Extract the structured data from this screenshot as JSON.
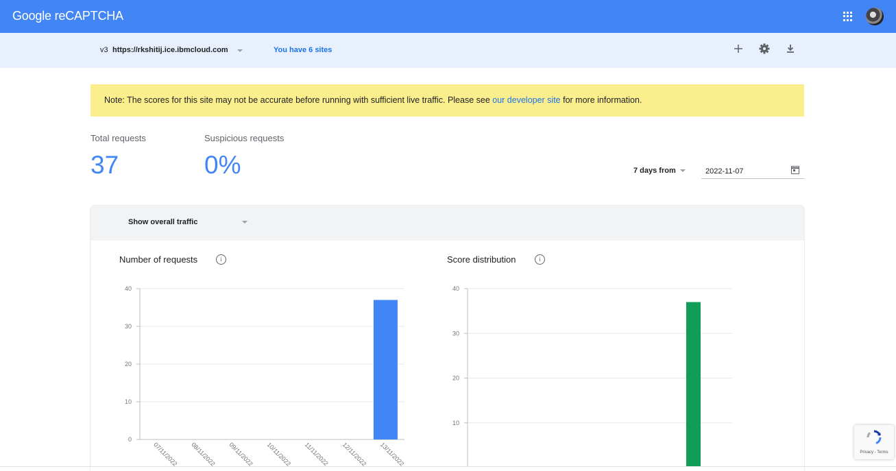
{
  "header": {
    "brand_google": "Google",
    "brand_product": "reCAPTCHA",
    "apps_icon": "apps-grid-icon",
    "avatar": "user-avatar"
  },
  "site_bar": {
    "version": "v3",
    "site_name": "https://rkshitij.ice.ibmcloud.com",
    "sites_link": "You have 6 sites",
    "actions": [
      "add-icon",
      "gear-icon",
      "download-icon"
    ]
  },
  "note": {
    "before_link": "Note: The scores for this site may not be accurate before running with sufficient live traffic. Please see ",
    "link_text": "our developer site",
    "after_link": " for more information."
  },
  "stats": {
    "total_label": "Total requests",
    "total_value": "37",
    "suspicious_label": "Suspicious requests",
    "suspicious_value": "0%"
  },
  "date_range": {
    "range_label": "7 days from",
    "date_value": "2022-11-07",
    "calendar_icon": "calendar-icon"
  },
  "traffic_selector": {
    "label": "Show overall traffic"
  },
  "colors": {
    "brand_blue": "#4285f4",
    "bar_blue": "#4285f4",
    "bar_green": "#0f9d58",
    "note_yellow": "#fbee8d"
  },
  "chart_data": [
    {
      "type": "bar",
      "title": "Number of requests",
      "categories": [
        "07/11/2022",
        "08/11/2022",
        "09/11/2022",
        "10/11/2022",
        "11/11/2022",
        "12/11/2022",
        "13/11/2022"
      ],
      "values": [
        0,
        0,
        0,
        0,
        0,
        0,
        37
      ],
      "yticks": [
        0,
        10,
        20,
        30,
        40
      ],
      "ylim": [
        0,
        40
      ],
      "grid": true,
      "color": "#4285f4"
    },
    {
      "type": "bar",
      "title": "Score distribution",
      "values": [
        37
      ],
      "yticks": [
        10,
        20,
        30,
        40
      ],
      "ylim": [
        0,
        40
      ],
      "grid": true,
      "color": "#0f9d58"
    }
  ],
  "recaptcha_badge": {
    "text": "Privacy - Terms"
  }
}
